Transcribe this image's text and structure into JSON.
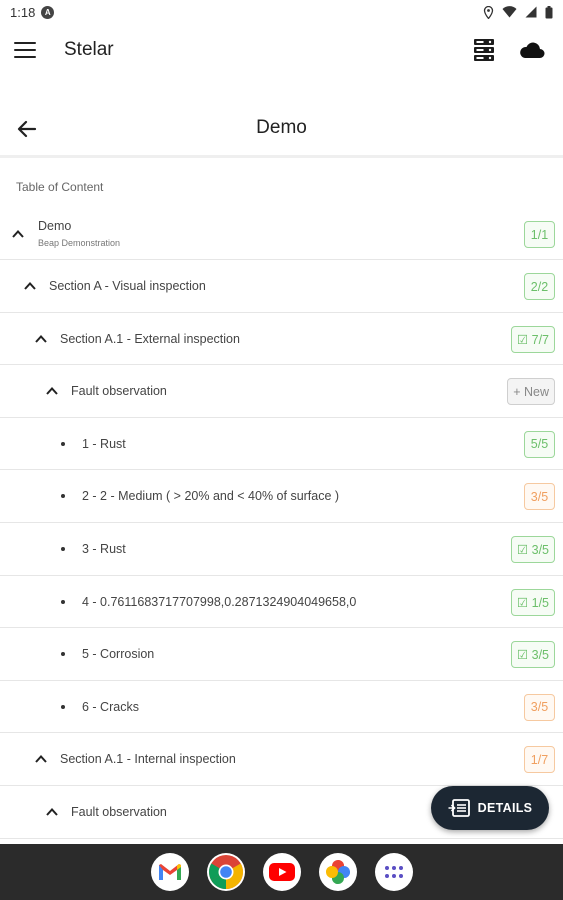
{
  "status_bar": {
    "time": "1:18",
    "notification_badge": "A"
  },
  "app_bar": {
    "title": "Stelar"
  },
  "header": {
    "title": "Demo"
  },
  "toc": {
    "label": "Table of Content"
  },
  "tree": {
    "root": {
      "label": "Demo",
      "sublabel": "Beap Demonstration",
      "badge": "1/1",
      "status": "green"
    },
    "rows": [
      {
        "label": "Section A - Visual inspection",
        "badge": "2/2",
        "status": "green"
      },
      {
        "label": "Section A.1 - External inspection",
        "badge": "☑ 7/7",
        "status": "green"
      },
      {
        "label": "Fault observation",
        "badge": "+ New",
        "status": "gray"
      },
      {
        "label": "1 - Rust",
        "badge": "5/5",
        "status": "green"
      },
      {
        "label": "2 - 2 - Medium ( > 20% and < 40% of surface )",
        "badge": "3/5",
        "status": "orange"
      },
      {
        "label": "3 - Rust",
        "badge": "☑ 3/5",
        "status": "green"
      },
      {
        "label": "4 - 0.7611683717707998,0.2871324904049658,0",
        "badge": "☑ 1/5",
        "status": "green"
      },
      {
        "label": "5 - Corrosion",
        "badge": "☑ 3/5",
        "status": "green"
      },
      {
        "label": "6 - Cracks",
        "badge": "3/5",
        "status": "orange"
      },
      {
        "label": "Section A.1 - Internal inspection",
        "badge": "1/7",
        "status": "orange"
      },
      {
        "label": "Fault observation"
      }
    ]
  },
  "fab": {
    "label": "DETAILS"
  },
  "dock": {
    "apps": [
      "Gmail",
      "Chrome",
      "YouTube",
      "Photos",
      "App drawer"
    ]
  },
  "colors": {
    "green": "#6cbf6a",
    "orange": "#f0a060",
    "fab_bg": "#1c2733",
    "dock_bg": "#2b2b2b"
  }
}
